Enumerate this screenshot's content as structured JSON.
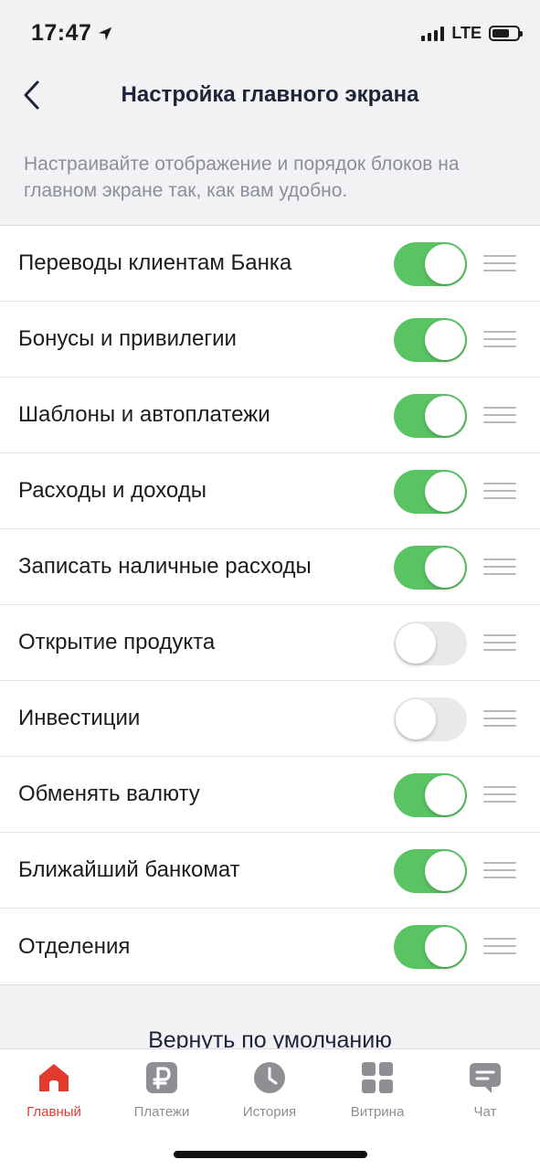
{
  "status": {
    "time": "17:47",
    "network": "LTE"
  },
  "header": {
    "title": "Настройка главного экрана"
  },
  "description": "Настраивайте отображение и порядок блоков на главном экране так, как вам удобно.",
  "blocks": [
    {
      "label": "Переводы клиентам Банка",
      "enabled": true
    },
    {
      "label": "Бонусы и привилегии",
      "enabled": true
    },
    {
      "label": "Шаблоны и автоплатежи",
      "enabled": true
    },
    {
      "label": "Расходы и доходы",
      "enabled": true
    },
    {
      "label": "Записать наличные расходы",
      "enabled": true
    },
    {
      "label": "Открытие продукта",
      "enabled": false
    },
    {
      "label": "Инвестиции",
      "enabled": false
    },
    {
      "label": "Обменять валюту",
      "enabled": true
    },
    {
      "label": "Ближайший банкомат",
      "enabled": true
    },
    {
      "label": "Отделения",
      "enabled": true
    }
  ],
  "reset_label": "Вернуть по умолчанию",
  "tabs": [
    {
      "label": "Главный",
      "icon": "home-icon",
      "active": true
    },
    {
      "label": "Платежи",
      "icon": "ruble-icon",
      "active": false
    },
    {
      "label": "История",
      "icon": "clock-icon",
      "active": false
    },
    {
      "label": "Витрина",
      "icon": "grid-icon",
      "active": false
    },
    {
      "label": "Чат",
      "icon": "chat-icon",
      "active": false
    }
  ],
  "colors": {
    "toggle_on": "#5ac463",
    "toggle_off": "#e9e9eb",
    "accent_red": "#e23b2e",
    "tab_inactive": "#8e8e93"
  }
}
